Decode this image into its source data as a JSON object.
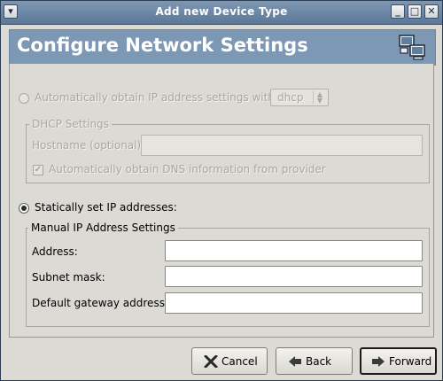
{
  "window": {
    "title": "Add new Device Type",
    "menu_icon": "window-menu-icon",
    "buttons": {
      "minimize": "_",
      "maximize": "□",
      "close": "✕"
    }
  },
  "header": {
    "title": "Configure Network Settings",
    "icon": "network-computer-icon"
  },
  "auto_ip": {
    "label": "Automatically obtain IP address settings with:",
    "selected": false,
    "enabled": false,
    "protocol": {
      "value": "dhcp",
      "options_visible": [
        "dhcp"
      ]
    }
  },
  "dhcp_settings": {
    "title": "DHCP Settings",
    "hostname_label": "Hostname (optional):",
    "hostname_value": "",
    "dns_checkbox_label": "Automatically obtain DNS information from provider",
    "dns_checked": true
  },
  "static_ip": {
    "label": "Statically set IP addresses:",
    "selected": true
  },
  "manual_settings": {
    "title": "Manual IP Address Settings",
    "fields": [
      {
        "label": "Address:",
        "value": ""
      },
      {
        "label": "Subnet mask:",
        "value": ""
      },
      {
        "label": "Default gateway address:",
        "value": ""
      }
    ]
  },
  "buttons": {
    "cancel": "Cancel",
    "back": "Back",
    "forward": "Forward"
  },
  "colors": {
    "titlebar": "#5c7898",
    "header_bg": "#7c98b4",
    "window_bg": "#dcdad5"
  }
}
